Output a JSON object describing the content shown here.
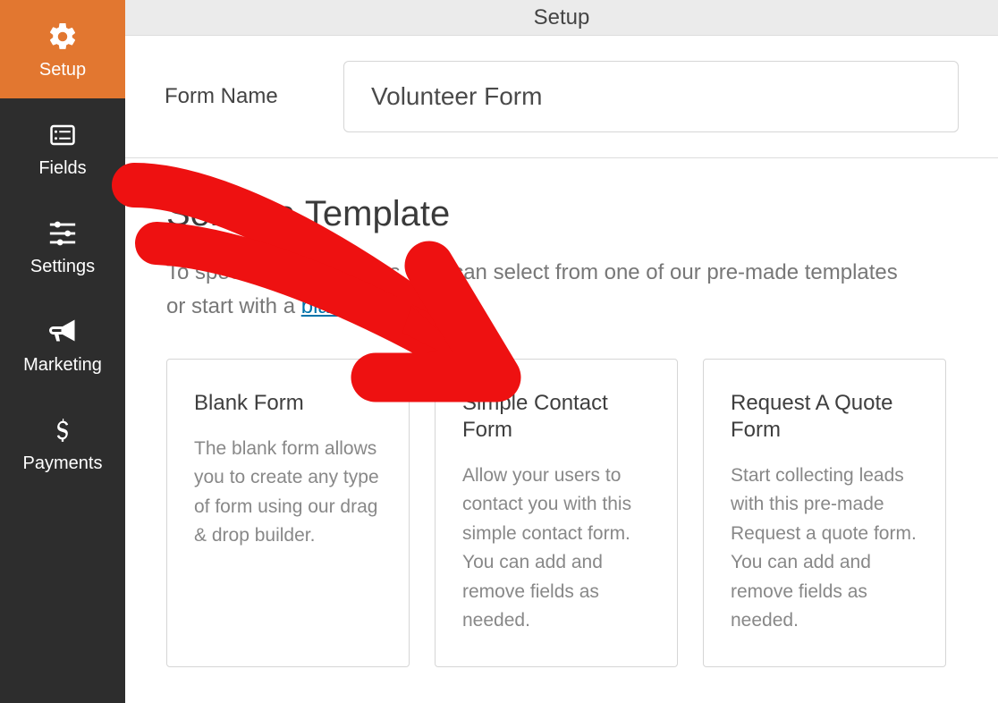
{
  "sidebar": {
    "items": [
      {
        "id": "setup",
        "label": "Setup",
        "active": true
      },
      {
        "id": "fields",
        "label": "Fields",
        "active": false
      },
      {
        "id": "settings",
        "label": "Settings",
        "active": false
      },
      {
        "id": "marketing",
        "label": "Marketing",
        "active": false
      },
      {
        "id": "payments",
        "label": "Payments",
        "active": false
      }
    ]
  },
  "header": {
    "title": "Setup"
  },
  "form_name": {
    "label": "Form Name",
    "value": "Volunteer Form"
  },
  "template_section": {
    "title": "Select a Template",
    "desc_before": "To speed up the process, you can select from one of our pre-made templates or start with a ",
    "link_text": "blank form.",
    "cards": [
      {
        "title": "Blank Form",
        "desc": "The blank form allows you to create any type of form using our drag & drop builder."
      },
      {
        "title": "Simple Contact Form",
        "desc": "Allow your users to contact you with this simple contact form. You can add and remove fields as needed."
      },
      {
        "title": "Request A Quote Form",
        "desc": "Start collecting leads with this pre-made Request a quote form. You can add and remove fields as needed."
      }
    ]
  }
}
